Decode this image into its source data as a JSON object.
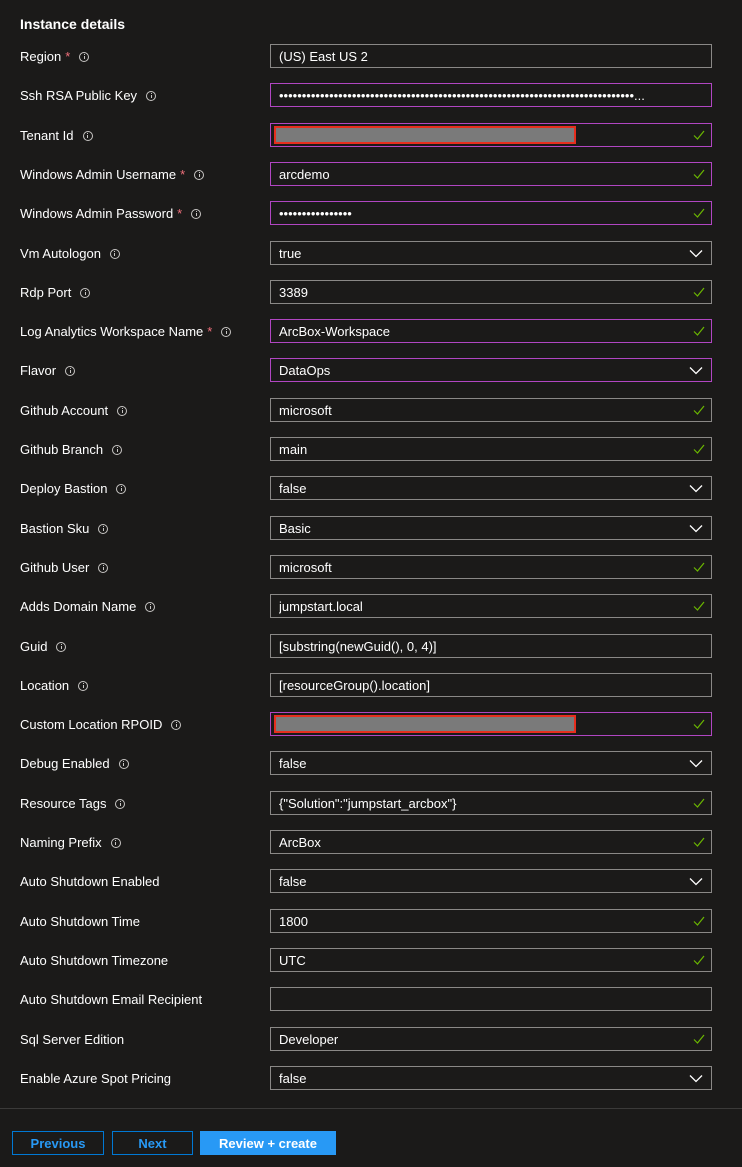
{
  "section_title": "Instance details",
  "fields": [
    {
      "label": "Region",
      "required": true,
      "info": true,
      "value": "(US) East US 2",
      "kind": "text",
      "check": false
    },
    {
      "label": "Ssh RSA Public Key",
      "required": false,
      "info": true,
      "value": "••••••••••••••••••••••••••••••••••••••••••••••••••••••••••••••••••••••••••••••...",
      "kind": "text",
      "check": false,
      "focus": true
    },
    {
      "label": "Tenant Id",
      "required": false,
      "info": true,
      "value": "",
      "kind": "redacted",
      "check": true,
      "focus": true
    },
    {
      "label": "Windows Admin Username",
      "required": true,
      "info": true,
      "value": "arcdemo",
      "kind": "text",
      "check": true,
      "focus": true
    },
    {
      "label": "Windows Admin Password",
      "required": true,
      "info": true,
      "value": "••••••••••••••••",
      "kind": "text",
      "check": true,
      "focus": true
    },
    {
      "label": "Vm Autologon",
      "required": false,
      "info": true,
      "value": "true",
      "kind": "select",
      "check": false
    },
    {
      "label": "Rdp Port",
      "required": false,
      "info": true,
      "value": "3389",
      "kind": "text",
      "check": true
    },
    {
      "label": "Log Analytics Workspace Name",
      "required": true,
      "info": true,
      "value": "ArcBox-Workspace",
      "kind": "text",
      "check": true,
      "focus": true
    },
    {
      "label": "Flavor",
      "required": false,
      "info": true,
      "value": "DataOps",
      "kind": "select",
      "check": false,
      "focus": true
    },
    {
      "label": "Github Account",
      "required": false,
      "info": true,
      "value": "microsoft",
      "kind": "text",
      "check": true
    },
    {
      "label": "Github Branch",
      "required": false,
      "info": true,
      "value": "main",
      "kind": "text",
      "check": true
    },
    {
      "label": "Deploy Bastion",
      "required": false,
      "info": true,
      "value": "false",
      "kind": "select",
      "check": false
    },
    {
      "label": "Bastion Sku",
      "required": false,
      "info": true,
      "value": "Basic",
      "kind": "select",
      "check": false
    },
    {
      "label": "Github User",
      "required": false,
      "info": true,
      "value": "microsoft",
      "kind": "text",
      "check": true
    },
    {
      "label": "Adds Domain Name",
      "required": false,
      "info": true,
      "value": "jumpstart.local",
      "kind": "text",
      "check": true
    },
    {
      "label": "Guid",
      "required": false,
      "info": true,
      "value": "[substring(newGuid(), 0, 4)]",
      "kind": "text",
      "check": false
    },
    {
      "label": "Location",
      "required": false,
      "info": true,
      "value": "[resourceGroup().location]",
      "kind": "text",
      "check": false
    },
    {
      "label": "Custom Location RPOID",
      "required": false,
      "info": true,
      "value": "",
      "kind": "redacted",
      "check": true,
      "focus": true
    },
    {
      "label": "Debug Enabled",
      "required": false,
      "info": true,
      "value": "false",
      "kind": "select",
      "check": false
    },
    {
      "label": "Resource Tags",
      "required": false,
      "info": true,
      "value": "{\"Solution\":\"jumpstart_arcbox\"}",
      "kind": "text",
      "check": true
    },
    {
      "label": "Naming Prefix",
      "required": false,
      "info": true,
      "value": "ArcBox",
      "kind": "text",
      "check": true
    },
    {
      "label": "Auto Shutdown Enabled",
      "required": false,
      "info": false,
      "value": "false",
      "kind": "select",
      "check": false
    },
    {
      "label": "Auto Shutdown Time",
      "required": false,
      "info": false,
      "value": "1800",
      "kind": "text",
      "check": true
    },
    {
      "label": "Auto Shutdown Timezone",
      "required": false,
      "info": false,
      "value": "UTC",
      "kind": "text",
      "check": true
    },
    {
      "label": "Auto Shutdown Email Recipient",
      "required": false,
      "info": false,
      "value": "",
      "kind": "text",
      "check": false
    },
    {
      "label": "Sql Server Edition",
      "required": false,
      "info": false,
      "value": "Developer",
      "kind": "text",
      "check": true
    },
    {
      "label": "Enable Azure Spot Pricing",
      "required": false,
      "info": false,
      "value": "false",
      "kind": "select",
      "check": false
    }
  ],
  "footer": {
    "previous_label": "Previous",
    "next_label": "Next",
    "review_label": "Review + create"
  },
  "colors": {
    "background": "#1b1a19",
    "field_border": "#8a8886",
    "focus_border": "#b146c2",
    "check": "#6bb700",
    "required": "#f1707b",
    "primary": "#2899f5",
    "redaction": "#e62e1e"
  }
}
